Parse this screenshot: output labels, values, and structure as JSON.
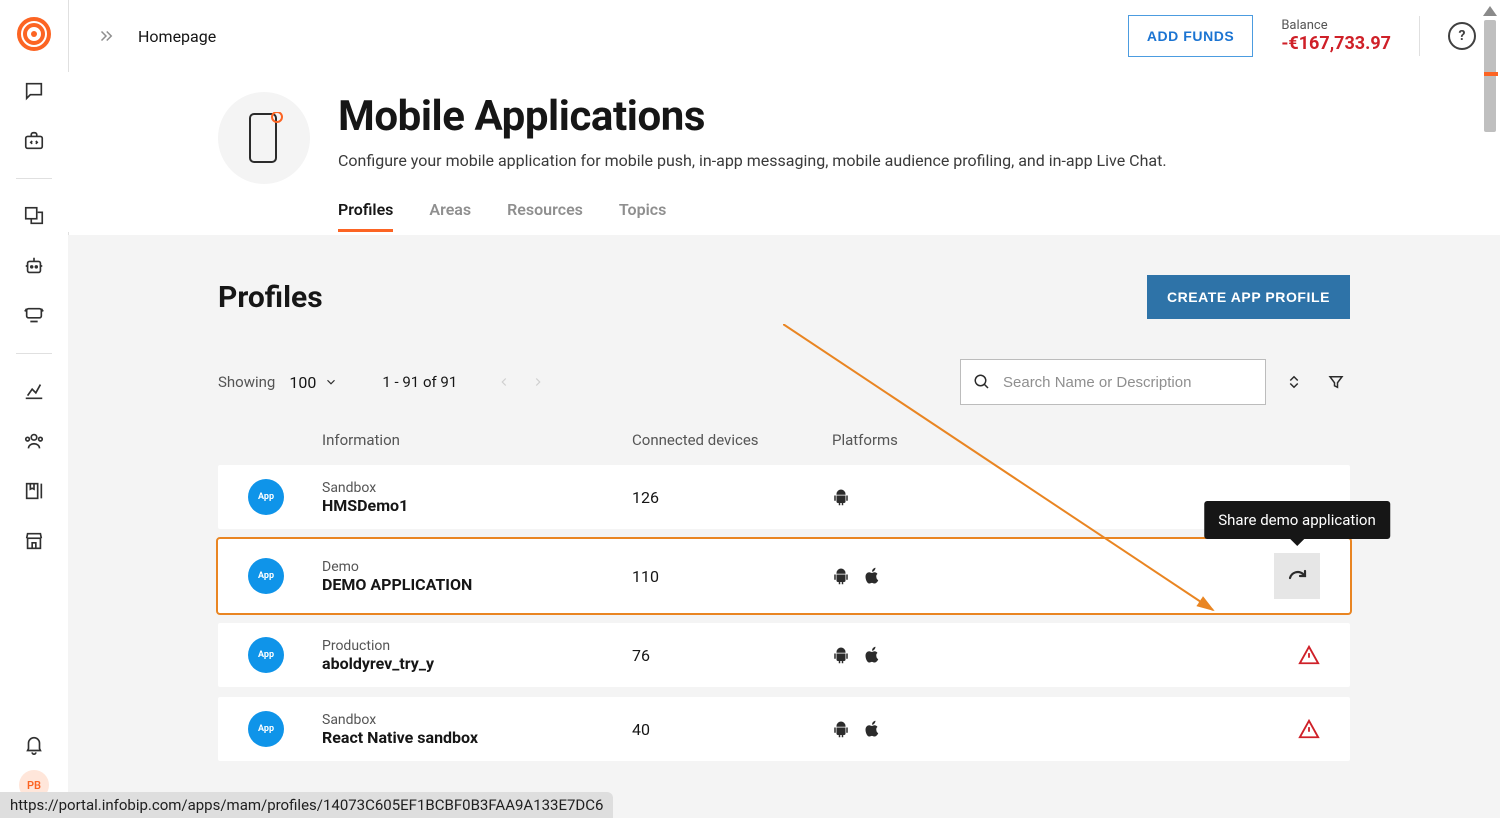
{
  "header": {
    "breadcrumb": "Homepage",
    "add_funds_label": "ADD FUNDS",
    "balance_label": "Balance",
    "balance_amount": "-€167,733.97",
    "help_label": "?"
  },
  "sidebar": {
    "avatar_initials": "PB"
  },
  "page": {
    "title": "Mobile Applications",
    "subtitle": "Configure your mobile application for mobile push, in-app messaging, mobile audience profiling, and in-app Live Chat."
  },
  "tabs": [
    {
      "label": "Profiles",
      "active": true
    },
    {
      "label": "Areas",
      "active": false
    },
    {
      "label": "Resources",
      "active": false
    },
    {
      "label": "Topics",
      "active": false
    }
  ],
  "profiles": {
    "section_title": "Profiles",
    "create_button": "CREATE APP PROFILE",
    "showing_label": "Showing",
    "page_size": "100",
    "paging_range": "1 - 91 of 91",
    "search_placeholder": "Search Name or Description",
    "columns": {
      "information": "Information",
      "connected": "Connected devices",
      "platforms": "Platforms"
    },
    "rows": [
      {
        "badge": "App",
        "tag": "Sandbox",
        "name": "HMSDemo1",
        "connected": "126",
        "platforms": [
          "android"
        ],
        "action": "none"
      },
      {
        "badge": "App",
        "tag": "Demo",
        "name": "DEMO APPLICATION",
        "connected": "110",
        "platforms": [
          "android",
          "apple"
        ],
        "action": "share"
      },
      {
        "badge": "App",
        "tag": "Production",
        "name": "aboldyrev_try_y",
        "connected": "76",
        "platforms": [
          "android",
          "apple"
        ],
        "action": "warning"
      },
      {
        "badge": "App",
        "tag": "Sandbox",
        "name": "React Native sandbox",
        "connected": "40",
        "platforms": [
          "android",
          "apple"
        ],
        "action": "warning"
      }
    ],
    "share_tooltip": "Share demo application"
  },
  "status_url": "https://portal.infobip.com/apps/mam/profiles/14073C605EF1BCBF0B3FAA9A133E7DC6"
}
